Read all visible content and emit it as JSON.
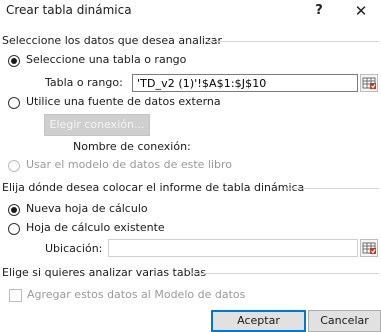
{
  "title": "Crear tabla dinámica",
  "titlebar": {
    "help": "?",
    "close": "✕"
  },
  "section1": {
    "heading": "Seleccione los datos que desea analizar",
    "option_table_range": "Seleccione una tabla o rango",
    "table_range_label": "Tabla o rango:",
    "table_range_value": "'TD_v2 (1)'!$A$1:$J$10",
    "option_external": "Utilice una fuente de datos externa",
    "choose_connection": "Elegir conexión...",
    "connection_name_label": "Nombre de conexión:",
    "option_data_model": "Usar el modelo de datos de este libro"
  },
  "section2": {
    "heading": "Elija dónde desea colocar el informe de tabla dinámica",
    "option_new_sheet": "Nueva hoja de cálculo",
    "option_existing_sheet": "Hoja de cálculo existente",
    "location_label": "Ubicación:",
    "location_value": ""
  },
  "section3": {
    "heading": "Elige si quieres analizar varias tablas",
    "add_to_model": "Agregar estos datos al Modelo de datos"
  },
  "buttons": {
    "accept": "Aceptar",
    "cancel": "Cancelar"
  },
  "colors": {
    "accent": "#0078d7",
    "disabled_text": "#9a9a9a"
  }
}
